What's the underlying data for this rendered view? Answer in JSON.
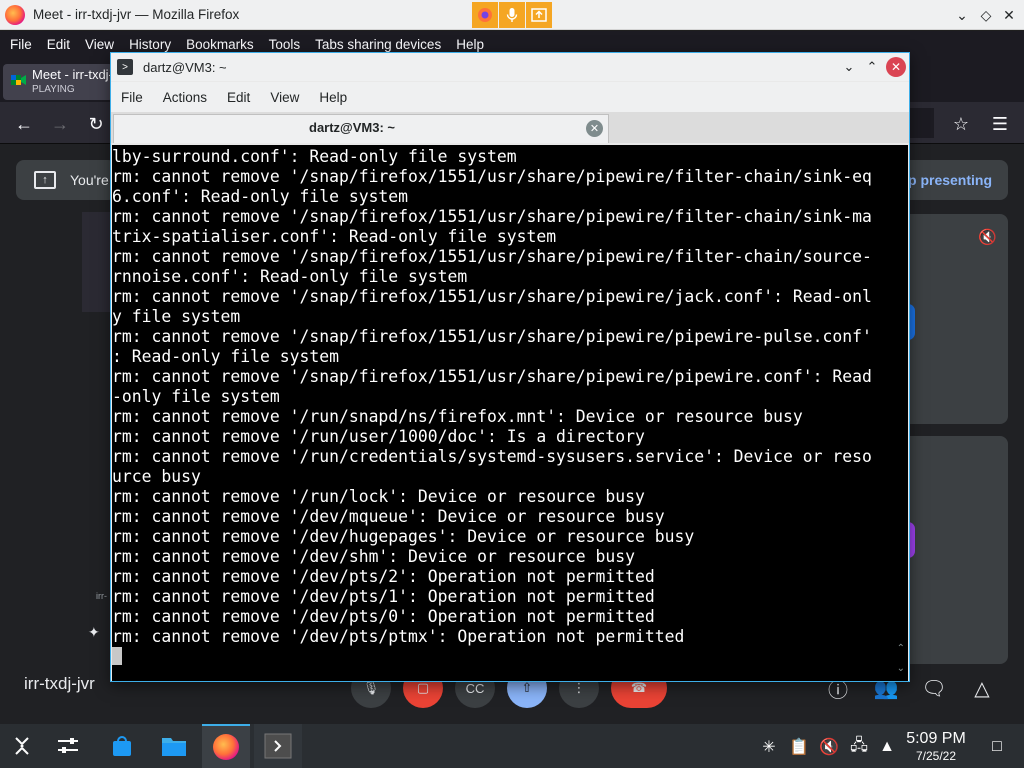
{
  "firefox": {
    "window_title": "Meet - irr-txdj-jvr — Mozilla Firefox",
    "menu": [
      "File",
      "Edit",
      "View",
      "History",
      "Bookmarks",
      "Tools",
      "Tabs sharing devices",
      "Help"
    ],
    "tab": {
      "title": "Meet - irr-txdj-jvr",
      "status": "PLAYING"
    }
  },
  "meet": {
    "presenting_text": "You're",
    "stop_presenting": "p presenting",
    "meeting_code": "irr-txdj-jvr",
    "mini_label": "irr-"
  },
  "terminal": {
    "title": "dartz@VM3: ~",
    "tab_title": "dartz@VM3: ~",
    "menu": [
      "File",
      "Actions",
      "Edit",
      "View",
      "Help"
    ],
    "lines": [
      "lby-surround.conf': Read-only file system",
      "rm: cannot remove '/snap/firefox/1551/usr/share/pipewire/filter-chain/sink-eq",
      "6.conf': Read-only file system",
      "rm: cannot remove '/snap/firefox/1551/usr/share/pipewire/filter-chain/sink-ma",
      "trix-spatialiser.conf': Read-only file system",
      "rm: cannot remove '/snap/firefox/1551/usr/share/pipewire/filter-chain/source-",
      "rnnoise.conf': Read-only file system",
      "rm: cannot remove '/snap/firefox/1551/usr/share/pipewire/jack.conf': Read-onl",
      "y file system",
      "rm: cannot remove '/snap/firefox/1551/usr/share/pipewire/pipewire-pulse.conf'",
      ": Read-only file system",
      "rm: cannot remove '/snap/firefox/1551/usr/share/pipewire/pipewire.conf': Read",
      "-only file system",
      "rm: cannot remove '/run/snapd/ns/firefox.mnt': Device or resource busy",
      "rm: cannot remove '/run/user/1000/doc': Is a directory",
      "rm: cannot remove '/run/credentials/systemd-sysusers.service': Device or reso",
      "urce busy",
      "rm: cannot remove '/run/lock': Device or resource busy",
      "rm: cannot remove '/dev/mqueue': Device or resource busy",
      "rm: cannot remove '/dev/hugepages': Device or resource busy",
      "rm: cannot remove '/dev/shm': Device or resource busy",
      "rm: cannot remove '/dev/pts/2': Operation not permitted",
      "rm: cannot remove '/dev/pts/1': Operation not permitted",
      "rm: cannot remove '/dev/pts/0': Operation not permitted",
      "rm: cannot remove '/dev/pts/ptmx': Operation not permitted"
    ]
  },
  "taskbar": {
    "time": "5:09 PM",
    "date": "7/25/22"
  },
  "colors": {
    "accent": "#3daee9",
    "terminal_bg": "#000000",
    "terminal_fg": "#ffffff",
    "end_call": "#ea4335",
    "share_active": "#8ab4f8"
  }
}
